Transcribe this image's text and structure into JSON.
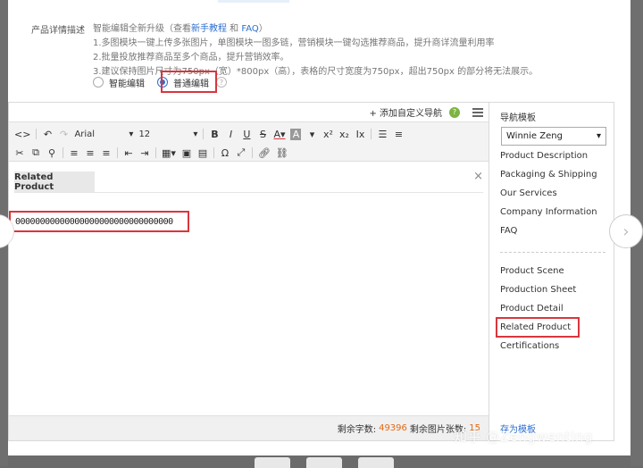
{
  "description": {
    "label": "产品详情描述",
    "intro_prefix": "智能编辑全新升级（查看",
    "intro_link1": "新手教程",
    "intro_mid": " 和 ",
    "intro_link2": "FAQ",
    "intro_suffix": "）",
    "tips": [
      "1.多图模块一键上传多张图片，单图模块一图多链，营销模块一键勾选推荐商品，提升商详流量利用率",
      "2.批量投放推荐商品至多个商品，提升营销效率。",
      "3.建议保持图片尺寸为750px（宽）*800px（高），表格的尺寸宽度为750px，超出750px 的部分将无法展示。"
    ]
  },
  "editor_mode": {
    "options": [
      {
        "label": "智能编辑",
        "selected": false
      },
      {
        "label": "普通编辑",
        "selected": true
      }
    ],
    "help": "?"
  },
  "editor": {
    "add_nav_label": "+ 添加自定义导航",
    "help": "?",
    "toolbar": {
      "font_family": "Arial",
      "font_size": "12"
    },
    "section_tab": "Related Product",
    "close": "×",
    "content_text": "00000000000000000000000000000000",
    "status": {
      "chars_label": "剩余字数:",
      "chars_value": "49396",
      "images_label": "剩余图片张数:",
      "images_value": "15"
    }
  },
  "nav_panel": {
    "title": "导航模板",
    "selected_template": "Winnie Zeng",
    "items_top": [
      "Product Description",
      "Packaging & Shipping",
      "Our Services",
      "Company Information",
      "FAQ"
    ],
    "items_bottom": [
      "Product Scene",
      "Production Sheet",
      "Product Detail",
      "Related Product",
      "Certifications"
    ],
    "bottom_link": "存为模板"
  },
  "watermark": "知乎 @Zengwenting",
  "colors": {
    "accent": "#2d6fd0",
    "highlight_box": "#d9363e",
    "count": "#e26a16"
  }
}
